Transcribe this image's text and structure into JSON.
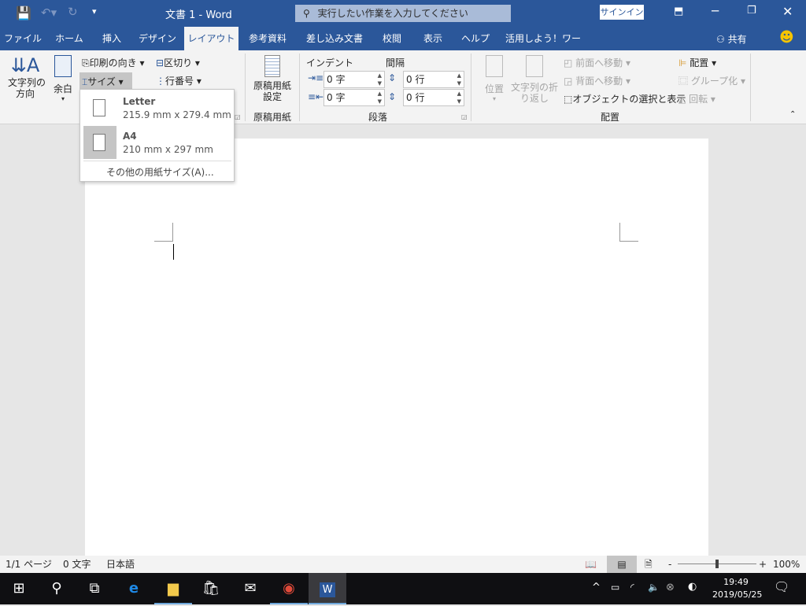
{
  "title": {
    "doc": "文書 1 - Word",
    "search_placeholder": "実行したい作業を入力してください",
    "signin": "サインイン"
  },
  "tabs": [
    "ファイル",
    "ホーム",
    "挿入",
    "デザイン",
    "レイアウト",
    "参考資料",
    "差し込み文書",
    "校閲",
    "表示",
    "ヘルプ",
    "活用しよう！ワード"
  ],
  "share": "共有",
  "ribbon": {
    "text_direction": "文字列の\n方向",
    "margins": "余白",
    "orientation": "印刷の向き",
    "size": "サイズ",
    "breaks": "区切り",
    "line_numbers": "行番号",
    "manuscript": "原稿用紙\n設定",
    "manuscript_group": "原稿用紙",
    "indent_label": "インデント",
    "spacing_label": "間隔",
    "indent_left": "0 字",
    "indent_right": "0 字",
    "spacing_before": "0 行",
    "spacing_after": "0 行",
    "paragraph_group": "段落",
    "position": "位置",
    "wrap_text": "文字列の折\nり返し",
    "bring_forward": "前面へ移動",
    "send_backward": "背面へ移動",
    "selection_pane": "オブジェクトの選択と表示",
    "align": "配置",
    "group": "グループ化",
    "rotate": "回転",
    "arrange_group": "配置"
  },
  "size_menu": {
    "items": [
      {
        "name": "Letter",
        "dims": "215.9 mm x 279.4 mm",
        "selected": false
      },
      {
        "name": "A4",
        "dims": "210 mm x 297 mm",
        "selected": true
      }
    ],
    "more": "その他の用紙サイズ(A)..."
  },
  "status": {
    "page": "1/1 ページ",
    "words": "0 文字",
    "language": "日本語",
    "zoom": "100%",
    "zoom_value": 100
  },
  "taskbar": {
    "time": "19:49",
    "date": "2019/05/25"
  }
}
